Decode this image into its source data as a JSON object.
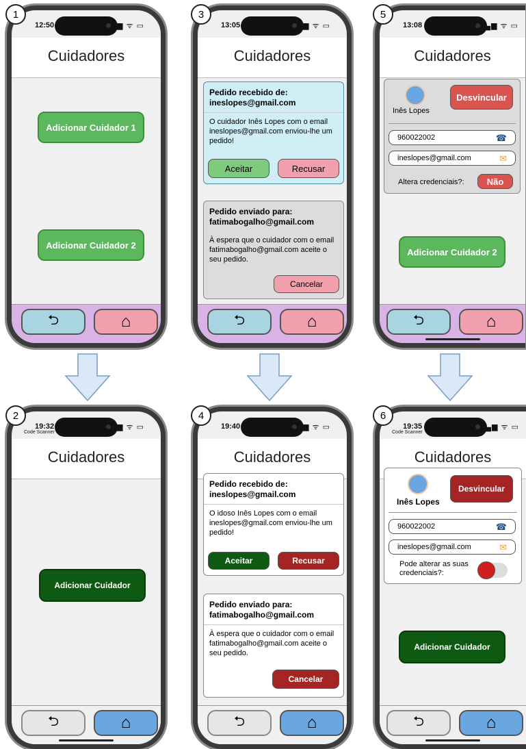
{
  "screens": [
    {
      "step": "1",
      "time": "12:50",
      "sub": "",
      "title": "Cuidadores",
      "add1": "Adicionar Cuidador 1",
      "add2": "Adicionar Cuidador 2"
    },
    {
      "step": "2",
      "time": "19:32",
      "sub": "Code Scanner",
      "title": "Cuidadores",
      "add": "Adicionar Cuidador"
    },
    {
      "step": "3",
      "time": "13:05",
      "sub": "",
      "title": "Cuidadores",
      "rx_title": "Pedido recebido de:",
      "rx_email": "ineslopes@gmail.com",
      "rx_body": "O cuidador Inês Lopes com o email ineslopes@gmail.com enviou-lhe um pedido!",
      "accept": "Aceitar",
      "refuse": "Recusar",
      "tx_title": "Pedido enviado para:",
      "tx_email": "fatimabogalho@gmail.com",
      "tx_body": "À espera que o cuidador com o email fatimabogalho@gmail.com aceite o seu pedido.",
      "cancel": "Cancelar"
    },
    {
      "step": "4",
      "time": "19:40",
      "sub": "",
      "title": "Cuidadores",
      "rx_title": "Pedido recebido de:",
      "rx_email": "ineslopes@gmail.com",
      "rx_body": "O idoso Inês Lopes com o email ineslopes@gmail.com enviou-lhe um pedido!",
      "accept": "Aceitar",
      "refuse": "Recusar",
      "tx_title": "Pedido enviado para:",
      "tx_email": "fatimabogalho@gmail.com",
      "tx_body": "À espera que o cuidador com o email fatimabogalho@gmail.com aceite o seu pedido.",
      "cancel": "Cancelar"
    },
    {
      "step": "5",
      "time": "13:08",
      "sub": "",
      "title": "Cuidadores",
      "name": "Inês Lopes",
      "unlink": "Desvincular",
      "phone": "960022002",
      "email": "ineslopes@gmail.com",
      "cred_label": "Altera credenciais?:",
      "cred_value": "Não",
      "add2": "Adicionar Cuidador 2"
    },
    {
      "step": "6",
      "time": "19:35",
      "sub": "Code Scanner",
      "title": "Cuidadores",
      "name": "Inês Lopes",
      "unlink": "Desvincular",
      "phone": "960022002",
      "email": "ineslopes@gmail.com",
      "cred_label": "Pode alterar as suas credenciais?:",
      "add": "Adicionar Cuidador"
    }
  ],
  "status_icons": "▂▄▆ ᯤ ▭",
  "icons": {
    "back": "⮌",
    "home": "⌂",
    "phone": "☎",
    "mail": "✉"
  },
  "colors": {
    "green_light": "#5cb85c",
    "green_dark": "#0f5a12",
    "pink": "#f2a0ad",
    "blue_light": "#a9d5e3",
    "blue_dark": "#6aa6df",
    "purple": "#d9b3e6",
    "red": "#d9534f",
    "red_dark": "#a52424"
  }
}
